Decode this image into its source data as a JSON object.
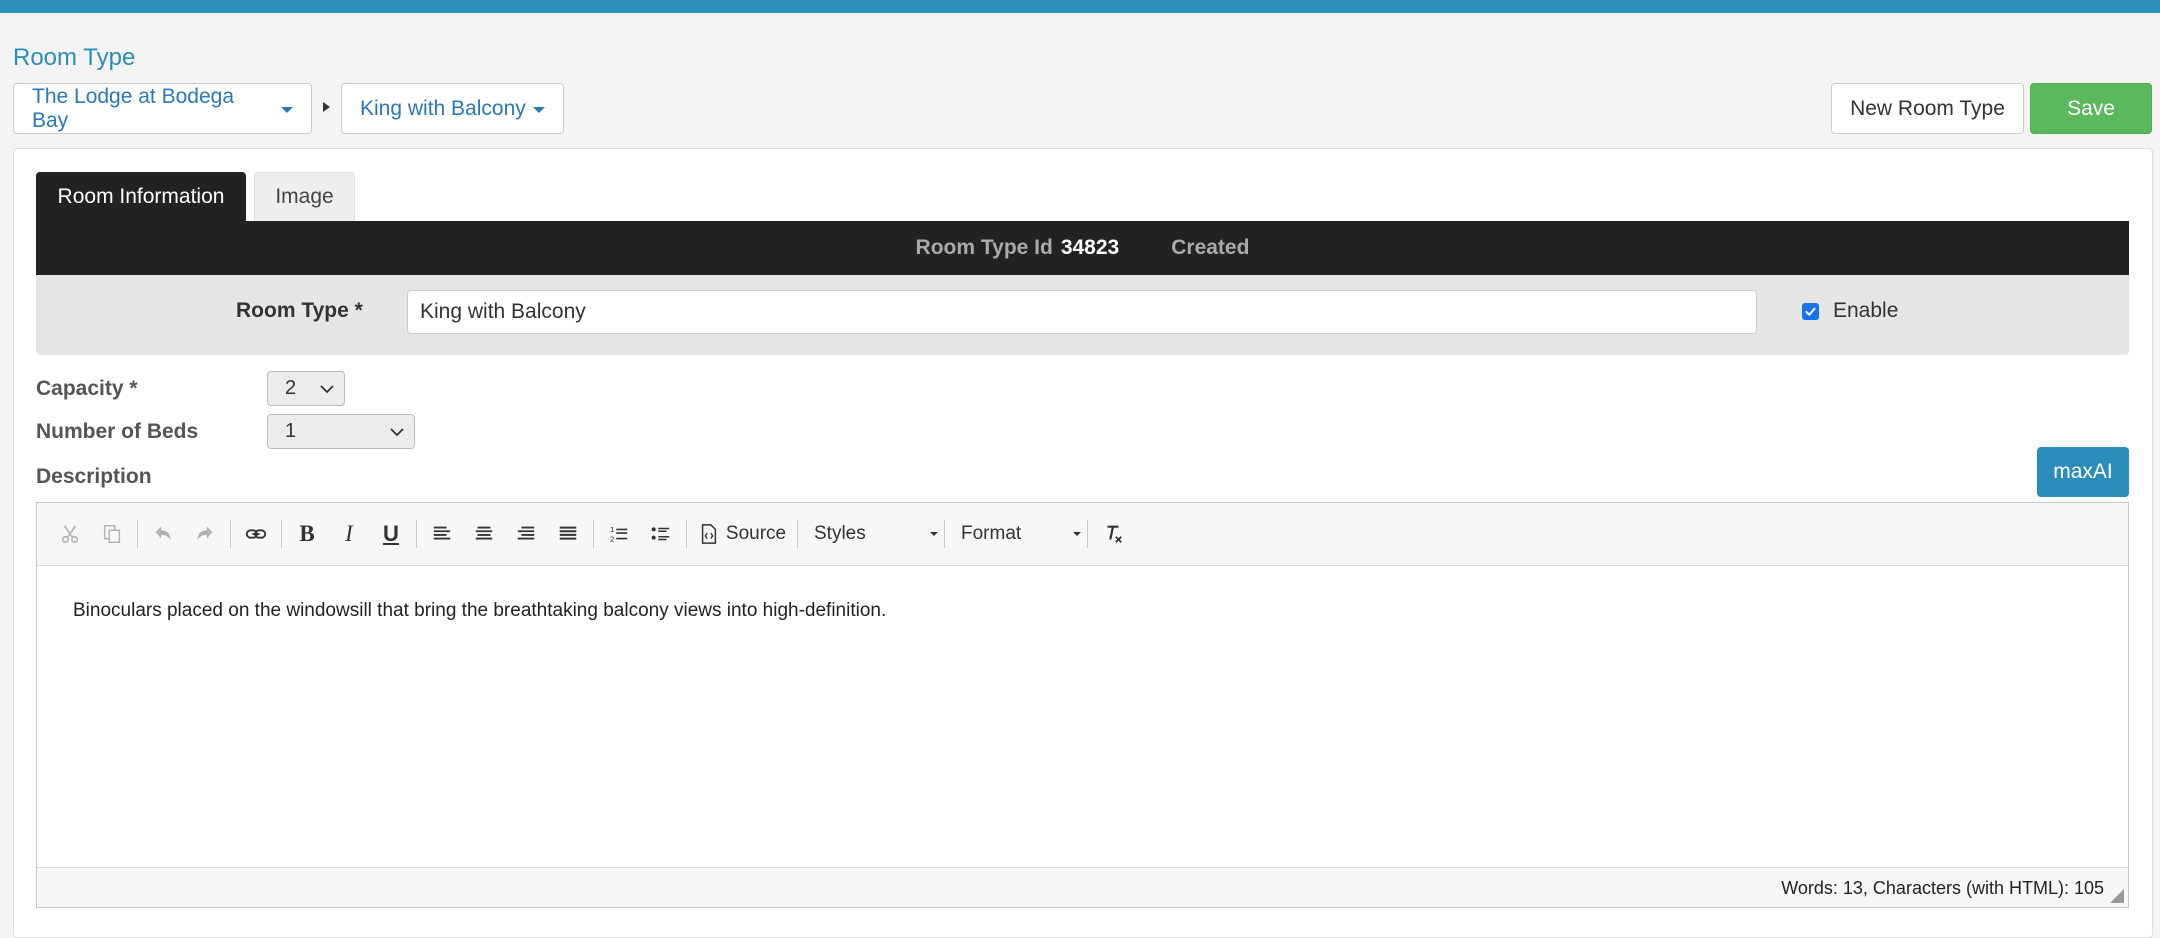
{
  "page": {
    "title": "Room Type"
  },
  "breadcrumb": {
    "property": "The Lodge at Bodega Bay",
    "room_type": "King with Balcony"
  },
  "actions": {
    "new_label": "New Room Type",
    "save_label": "Save"
  },
  "tabs": [
    {
      "label": "Room Information",
      "active": true
    },
    {
      "label": "Image",
      "active": false
    }
  ],
  "info_bar": {
    "id_label": "Room Type Id",
    "id_value": "34823",
    "created_label": "Created"
  },
  "form": {
    "room_type_label": "Room Type *",
    "room_type_value": "King with Balcony",
    "enable_label": "Enable",
    "enable_checked": true,
    "capacity_label": "Capacity *",
    "capacity_value": "2",
    "beds_label": "Number of Beds",
    "beds_value": "1",
    "description_label": "Description"
  },
  "maxai_label": "maxAI",
  "editor": {
    "toolbar": {
      "source_label": "Source",
      "styles_label": "Styles",
      "format_label": "Format"
    },
    "content": "Binoculars placed on the windowsill that bring the breathtaking balcony views into high-definition.",
    "status": "Words: 13, Characters (with HTML): 105"
  },
  "colors": {
    "accent": "#2a8dba",
    "save": "#5cb85c",
    "dark_bar": "#222222",
    "link": "#2a78b8"
  }
}
